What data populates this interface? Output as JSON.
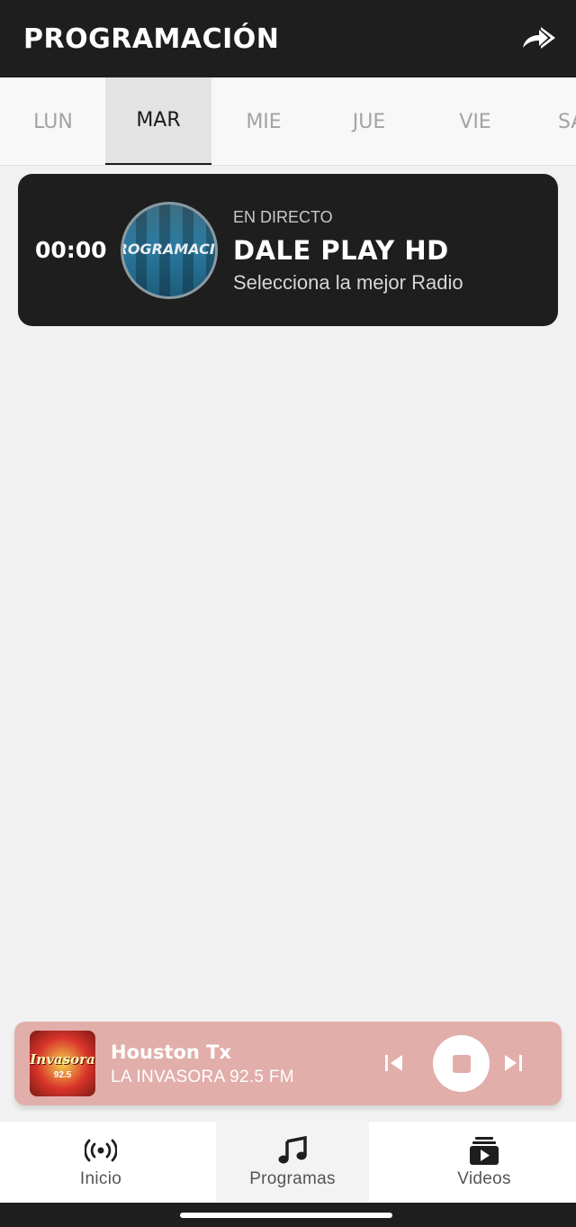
{
  "header": {
    "title": "PROGRAMACIÓN",
    "share_icon": "share-arrow-icon"
  },
  "days": [
    {
      "label": "LUN",
      "active": false
    },
    {
      "label": "MAR",
      "active": true
    },
    {
      "label": "MIE",
      "active": false
    },
    {
      "label": "JUE",
      "active": false
    },
    {
      "label": "VIE",
      "active": false
    },
    {
      "label": "SA",
      "active": false
    }
  ],
  "program": {
    "time": "00:00",
    "logo_text": "ROGRAMACIO",
    "status": "EN DIRECTO",
    "name": "DALE PLAY HD",
    "description": "Selecciona la mejor Radio"
  },
  "player": {
    "title": "Houston Tx",
    "subtitle": "LA INVASORA 92.5 FM",
    "art_text": "Invasora",
    "art_subtext": "92.5",
    "accent": "#e2aeaa"
  },
  "nav": {
    "items": [
      {
        "label": "Inicio",
        "icon": "broadcast-icon"
      },
      {
        "label": "Programas",
        "icon": "music-note-icon"
      },
      {
        "label": "Videos",
        "icon": "video-library-icon"
      }
    ]
  },
  "colors": {
    "header_bg": "#1e1e1e",
    "page_bg": "#f1f1f1",
    "card_bg": "#1e1e1e"
  }
}
